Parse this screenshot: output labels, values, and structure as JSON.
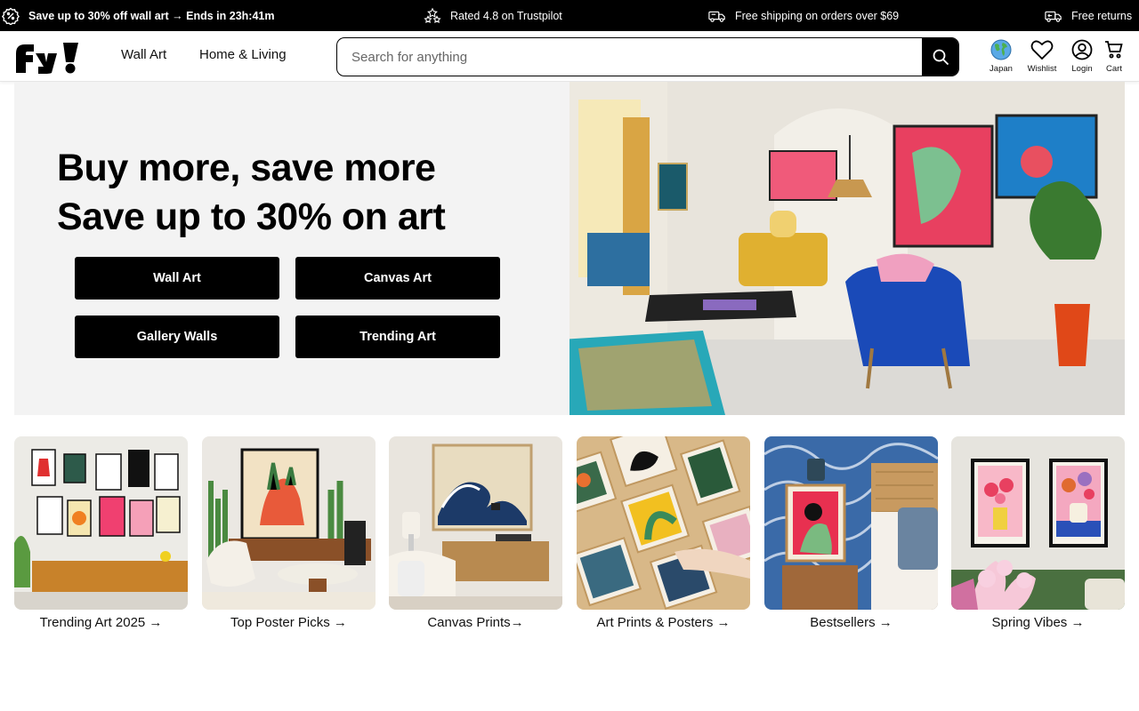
{
  "announcement": {
    "promo": "Save up to 30% off wall art → Ends in 23h:41m",
    "rating": "Rated 4.8 on Trustpilot",
    "shipping": "Free shipping on orders over $69",
    "returns": "Free returns"
  },
  "header": {
    "logo_text": "fy!",
    "nav": {
      "wall_art": "Wall Art",
      "home_living": "Home & Living"
    },
    "search": {
      "placeholder": "Search for anything"
    },
    "actions": {
      "region": "Japan",
      "wishlist": "Wishlist",
      "login": "Login",
      "cart": "Cart"
    }
  },
  "hero": {
    "title_line1": "Buy more, save more",
    "title_line2": "Save up to 30% on art",
    "buttons": [
      "Wall Art",
      "Canvas Art",
      "Gallery Walls",
      "Trending Art"
    ]
  },
  "categories": [
    {
      "label": "Trending Art 2025 →"
    },
    {
      "label": "Top Poster Picks →"
    },
    {
      "label": "Canvas Prints→"
    },
    {
      "label": "Art Prints & Posters →"
    },
    {
      "label": "Bestsellers →"
    },
    {
      "label": "Spring Vibes →"
    }
  ],
  "colors": {
    "announcement_bg": "#000000",
    "hero_bg": "#f3f3f3",
    "button_bg": "#000000"
  }
}
